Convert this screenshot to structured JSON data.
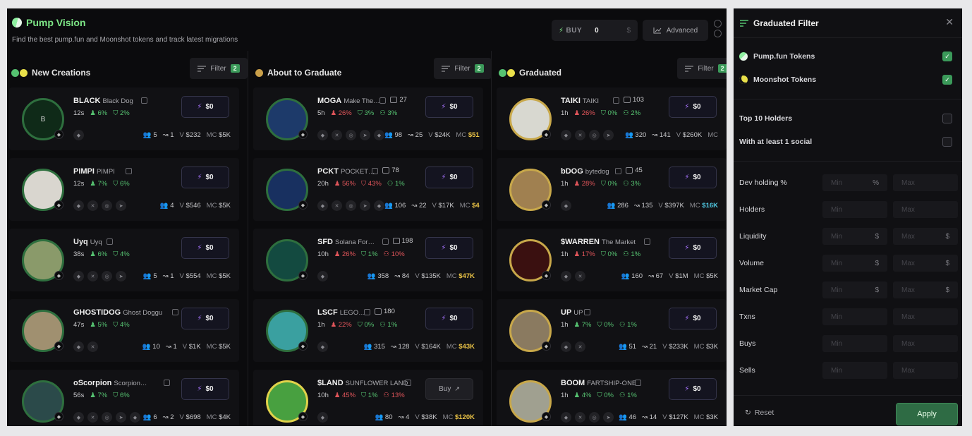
{
  "header": {
    "title": "Pump Vision",
    "subtitle": "Find the best pump.fun and Moonshot tokens and track latest migrations",
    "buy_label": "BUY",
    "buy_value": "0",
    "buy_unit": "$",
    "advanced_label": "Advanced"
  },
  "columns": [
    {
      "title": "New Creations",
      "filter_label": "Filter",
      "filter_count": "2",
      "tokens": [
        {
          "ticker": "BLACK",
          "name": "Black Dog",
          "comments": "",
          "age": "12s",
          "h1": "6%",
          "h2": "2%",
          "holders": "5",
          "txns": "1",
          "vol": "$232",
          "mc": "$5K",
          "buy": "$0",
          "init": "B"
        },
        {
          "ticker": "PIMPI",
          "name": "PIMPI",
          "comments": "",
          "age": "12s",
          "h1": "7%",
          "h2": "6%",
          "holders": "4",
          "txns": "",
          "vol": "$546",
          "mc": "$5K",
          "buy": "$0"
        },
        {
          "ticker": "Uyq",
          "name": "Uyq",
          "comments": "",
          "age": "38s",
          "h1": "6%",
          "h2": "4%",
          "holders": "5",
          "txns": "1",
          "vol": "$554",
          "mc": "$5K",
          "buy": "$0"
        },
        {
          "ticker": "GHOSTIDOG",
          "name": "Ghost Doggu",
          "comments": "",
          "age": "47s",
          "h1": "5%",
          "h2": "4%",
          "holders": "10",
          "txns": "1",
          "vol": "$1K",
          "mc": "$5K",
          "buy": "$0"
        },
        {
          "ticker": "oScorpion",
          "name": "Scorpion…",
          "comments": "",
          "age": "56s",
          "h1": "7%",
          "h2": "6%",
          "holders": "6",
          "txns": "2",
          "vol": "$698",
          "mc": "$4K",
          "buy": "$0"
        }
      ]
    },
    {
      "title": "About to Graduate",
      "filter_label": "Filter",
      "filter_count": "2",
      "tokens": [
        {
          "ticker": "MOGA",
          "name": "Make The…",
          "comments": "27",
          "age": "5h",
          "h1": "26%",
          "h2": "3%",
          "h3": "3%",
          "holders": "98",
          "txns": "25",
          "vol": "$24K",
          "mc": "$51",
          "buy": "$0"
        },
        {
          "ticker": "PCKT",
          "name": "POCKET…",
          "comments": "78",
          "age": "20h",
          "h1": "56%",
          "h2": "43%",
          "h3": "1%",
          "holders": "106",
          "txns": "22",
          "vol": "$17K",
          "mc": "$4",
          "buy": "$0"
        },
        {
          "ticker": "SFD",
          "name": "Solana For…",
          "comments": "198",
          "age": "10h",
          "h1": "26%",
          "h2": "1%",
          "h3": "10%",
          "holders": "358",
          "txns": "84",
          "vol": "$135K",
          "mc": "$47K",
          "buy": "$0"
        },
        {
          "ticker": "LSCF",
          "name": "LEGO…",
          "comments": "180",
          "age": "1h",
          "h1": "22%",
          "h2": "0%",
          "h3": "1%",
          "holders": "315",
          "txns": "128",
          "vol": "$164K",
          "mc": "$43K",
          "buy": "$0"
        },
        {
          "ticker": "$LAND",
          "name": "SUNFLOWER LAND",
          "comments": "",
          "age": "10h",
          "h1": "45%",
          "h2": "1%",
          "h3": "13%",
          "holders": "80",
          "txns": "4",
          "vol": "$38K",
          "mc": "$120K",
          "buy": "Buy"
        }
      ]
    },
    {
      "title": "Graduated",
      "filter_label": "Filter",
      "filter_count": "2",
      "tokens": [
        {
          "ticker": "TAIKI",
          "name": "TAIKI",
          "comments": "103",
          "age": "1h",
          "h1": "26%",
          "h2": "0%",
          "h3": "2%",
          "holders": "320",
          "txns": "141",
          "vol": "$260K",
          "mc": "",
          "buy": "$0"
        },
        {
          "ticker": "bDOG",
          "name": "bytedog",
          "comments": "45",
          "age": "1h",
          "h1": "28%",
          "h2": "0%",
          "h3": "3%",
          "holders": "286",
          "txns": "135",
          "vol": "$397K",
          "mc": "$16K",
          "buy": "$0"
        },
        {
          "ticker": "$WARREN",
          "name": "The Market",
          "comments": "",
          "age": "1h",
          "h1": "17%",
          "h2": "0%",
          "h3": "1%",
          "holders": "160",
          "txns": "67",
          "vol": "$1M",
          "mc": "$5K",
          "buy": "$0"
        },
        {
          "ticker": "UP",
          "name": "UP",
          "comments": "",
          "age": "1h",
          "h1": "7%",
          "h2": "0%",
          "h3": "1%",
          "holders": "51",
          "txns": "21",
          "vol": "$233K",
          "mc": "$3K",
          "buy": "$0"
        },
        {
          "ticker": "BOOM",
          "name": "FARTSHIP-ONE",
          "comments": "",
          "age": "1h",
          "h1": "4%",
          "h2": "0%",
          "h3": "1%",
          "holders": "46",
          "txns": "14",
          "vol": "$127K",
          "mc": "$3K",
          "buy": "$0"
        }
      ]
    }
  ],
  "labels": {
    "v": "V",
    "mc": "MC"
  },
  "panel": {
    "title": "Graduated Filter",
    "pump_label": "Pump.fun Tokens",
    "moon_label": "Moonshot Tokens",
    "top10_label": "Top 10 Holders",
    "social_label": "With at least 1 social",
    "ranges": [
      {
        "label": "Dev holding %",
        "min": "Min",
        "max": "Max",
        "unit_min": "%",
        "unit_max": ""
      },
      {
        "label": "Holders",
        "min": "Min",
        "max": "Max",
        "unit_min": "",
        "unit_max": ""
      },
      {
        "label": "Liquidity",
        "min": "Min",
        "max": "Max",
        "unit_min": "$",
        "unit_max": "$"
      },
      {
        "label": "Volume",
        "min": "Min",
        "max": "Max",
        "unit_min": "$",
        "unit_max": "$"
      },
      {
        "label": "Market Cap",
        "min": "Min",
        "max": "Max",
        "unit_min": "$",
        "unit_max": "$"
      },
      {
        "label": "Txns",
        "min": "Min",
        "max": "Max",
        "unit_min": "",
        "unit_max": ""
      },
      {
        "label": "Buys",
        "min": "Min",
        "max": "Max",
        "unit_min": "",
        "unit_max": ""
      },
      {
        "label": "Sells",
        "min": "Min",
        "max": "Max",
        "unit_min": "",
        "unit_max": ""
      }
    ],
    "reset_label": "Reset",
    "apply_label": "Apply"
  },
  "colors": {
    "accent_green": "#3b9a5a",
    "title_green": "#7ee787",
    "bolt_purple": "#a874ff",
    "gold": "#e9c246"
  }
}
